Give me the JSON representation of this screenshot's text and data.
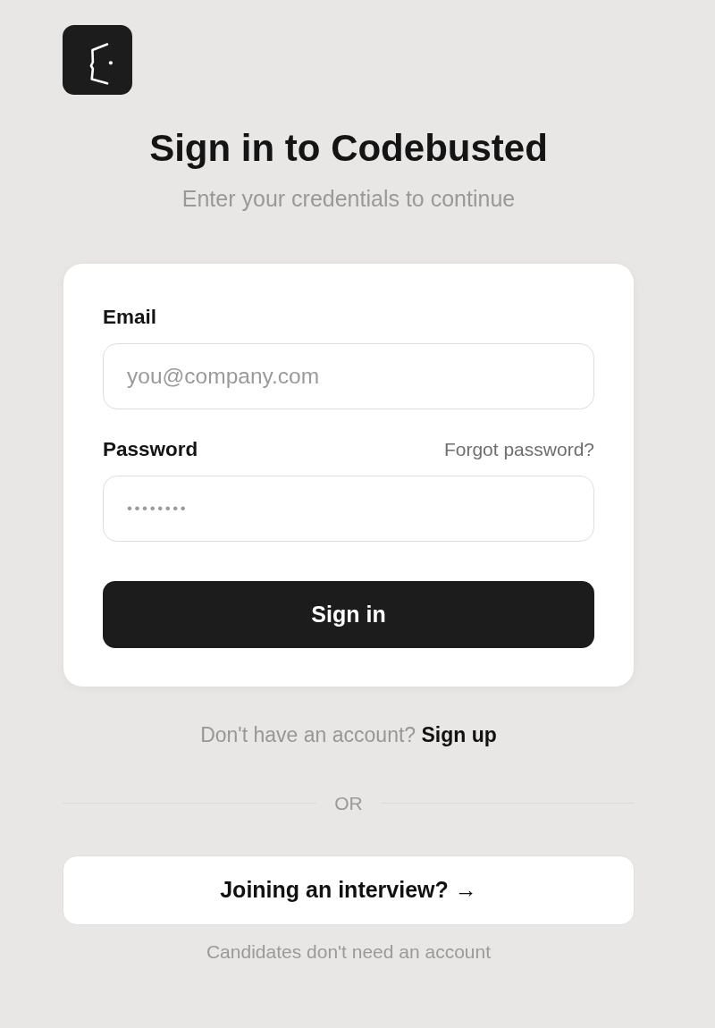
{
  "heading": "Sign in to Codebusted",
  "subtitle": "Enter your credentials to continue",
  "form": {
    "fields": [
      {
        "kind": "email",
        "label": "Email",
        "placeholder": "you@company.com"
      },
      {
        "kind": "password",
        "label": "Password",
        "link": "Forgot password?",
        "placeholder": "••••••••"
      }
    ],
    "submit": "Sign in"
  },
  "signup": {
    "prompt": "Don't have an account?",
    "link": "Sign up"
  },
  "divider": "OR",
  "interview_button": "Joining an interview? →",
  "note": "Candidates don't need an account"
}
